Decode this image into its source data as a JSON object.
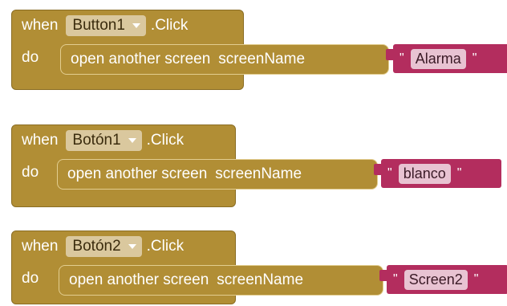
{
  "blocks": [
    {
      "when": "when",
      "component": "Button1",
      "event": ".Click",
      "do": "do",
      "call": "open another screen",
      "arg": "screenName",
      "quote_open": "\"",
      "text": "Alarma",
      "quote_close": "\""
    },
    {
      "when": "when",
      "component": "Botón1",
      "event": ".Click",
      "do": "do",
      "call": "open another screen",
      "arg": "screenName",
      "quote_open": "\"",
      "text": "blanco",
      "quote_close": "\""
    },
    {
      "when": "when",
      "component": "Botón2",
      "event": ".Click",
      "do": "do",
      "call": "open another screen",
      "arg": "screenName",
      "quote_open": "\"",
      "text": "Screen2",
      "quote_close": "\""
    }
  ],
  "colors": {
    "event_block": "#b18e35",
    "component_chip": "#dac89e",
    "text_block": "#b32d5e",
    "text_value": "#e8c3d2"
  }
}
